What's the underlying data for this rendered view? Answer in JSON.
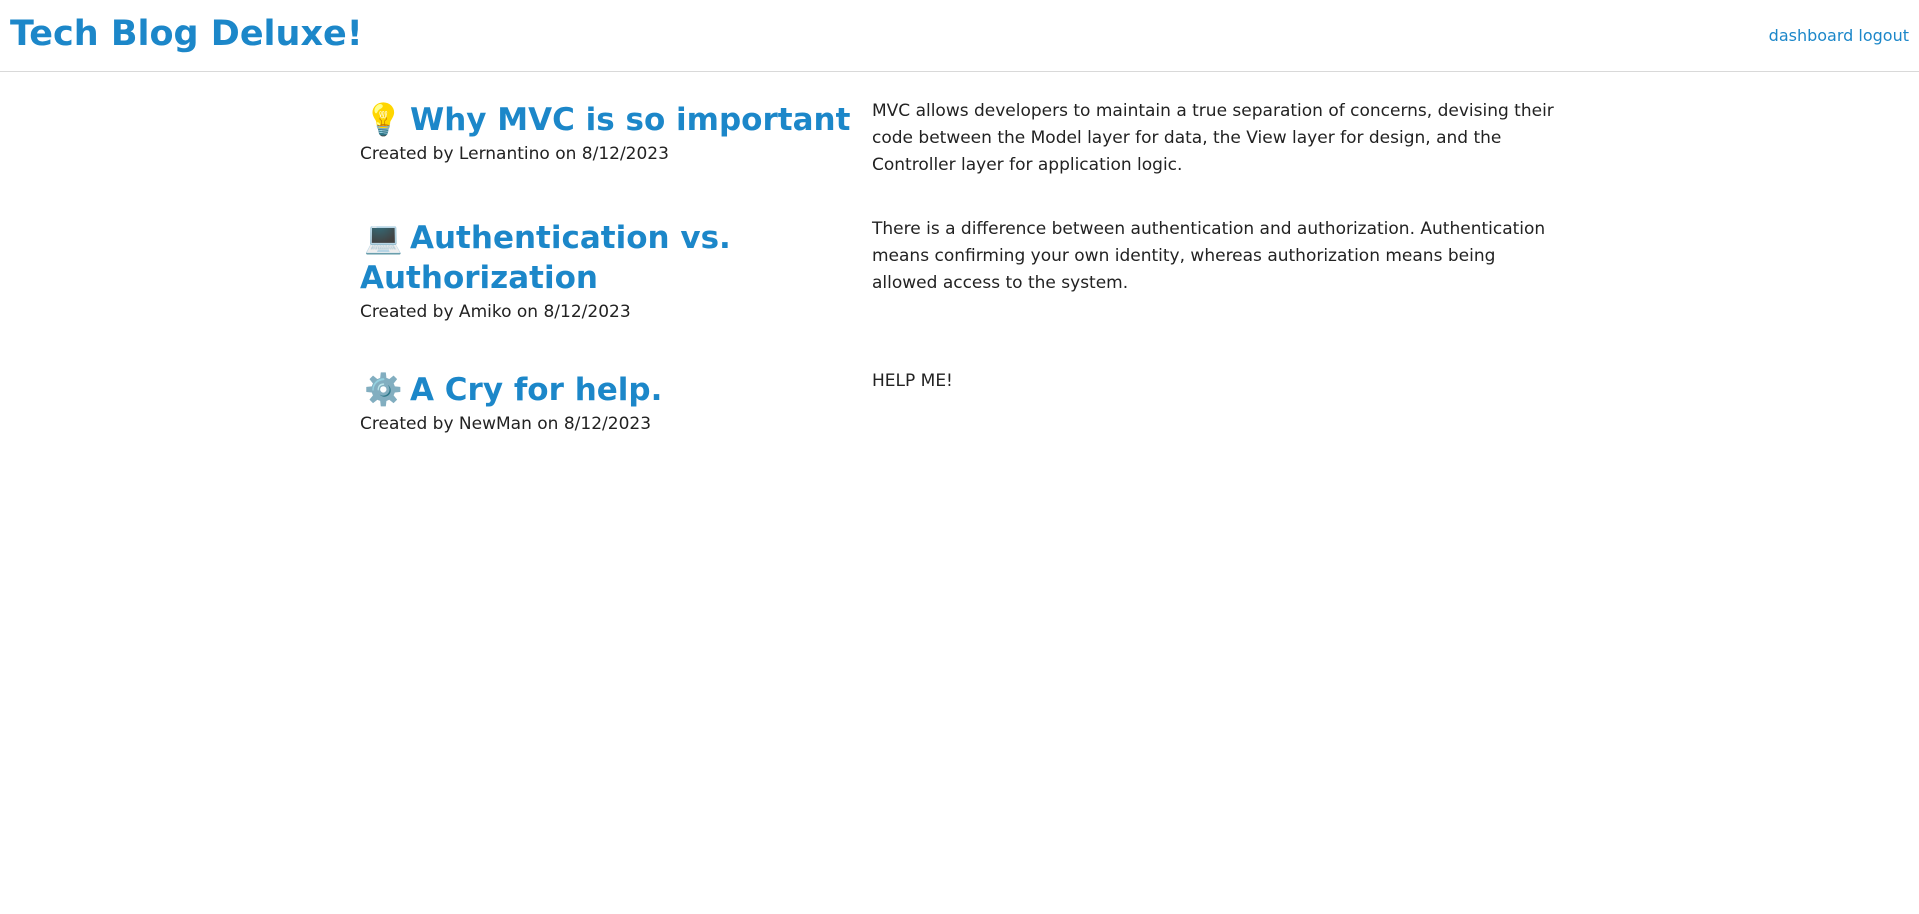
{
  "header": {
    "site_title": "Tech Blog Deluxe!",
    "nav": {
      "dashboard_label": "dashboard",
      "logout_label": "logout"
    }
  },
  "posts": [
    {
      "icon": "lightbulb-icon",
      "emoji": "💡",
      "title": "Why MVC is so important",
      "meta": "Created by Lernantino on 8/12/2023",
      "body": "MVC allows developers to maintain a true separation of concerns, devising their code between the Model layer for data, the View layer for design, and the Controller layer for application logic."
    },
    {
      "icon": "laptop-icon",
      "emoji": "💻",
      "title": "Authentication vs. Authorization",
      "meta": "Created by Amiko on 8/12/2023",
      "body": "There is a difference between authentication and authorization. Authentication means confirming your own identity, whereas authorization means being allowed access to the system."
    },
    {
      "icon": "gear-icon",
      "emoji": "⚙️",
      "title": "A Cry for help.",
      "meta": "Created by NewMan on 8/12/2023",
      "body": "HELP ME!"
    }
  ],
  "colors": {
    "accent": "#1c87c9",
    "text": "#222222",
    "divider": "#d9d9d9"
  }
}
